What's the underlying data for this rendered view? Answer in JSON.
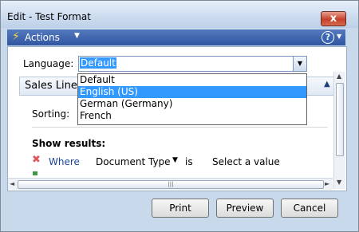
{
  "window": {
    "title": "Edit - Test Format",
    "close_label": "x"
  },
  "actionbar": {
    "actions_label": "Actions",
    "help_label": "?"
  },
  "form": {
    "language_label": "Language:",
    "language_value": "Default",
    "language_options": [
      "Default",
      "English (US)",
      "German (Germany)",
      "French"
    ],
    "language_highlighted": "English (US)",
    "fasttab_title": "Sales Line",
    "sorting_label": "Sorting:",
    "show_results_label": "Show results:",
    "filter": {
      "where_label": "Where",
      "field": "Document Type",
      "operator": "is",
      "value_placeholder": "Select a value"
    }
  },
  "buttons": {
    "print": "Print",
    "preview": "Preview",
    "cancel": "Cancel"
  },
  "colors": {
    "selection": "#3399ff",
    "actionbar": "#2f56a2",
    "link": "#1c4694"
  }
}
